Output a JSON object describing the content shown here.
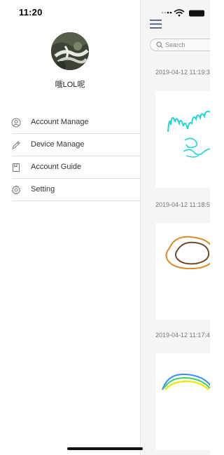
{
  "status": {
    "time": "11:20"
  },
  "profile": {
    "username": "哦LOL呢"
  },
  "menu": {
    "items": [
      {
        "label": "Account Manage",
        "icon": "user-circle-icon"
      },
      {
        "label": "Device Manage",
        "icon": "pen-icon"
      },
      {
        "label": "Account Guide",
        "icon": "book-icon"
      },
      {
        "label": "Setting",
        "icon": "gear-icon"
      }
    ]
  },
  "main": {
    "search": {
      "placeholder": "Search"
    },
    "notes": [
      {
        "timestamp": "2019-04-12 11:19:3"
      },
      {
        "timestamp": "2019-04-12 11:18:5"
      },
      {
        "timestamp": "2019-04-12 11:17:4"
      }
    ]
  },
  "colors": {
    "ink_cyan": "#22d3d9",
    "ink_orange": "#e08a2a",
    "ink_brown": "#6b4b2a",
    "ink_yellow": "#f2e600",
    "ink_green": "#3fd06b",
    "ink_blue": "#3a8cff"
  }
}
